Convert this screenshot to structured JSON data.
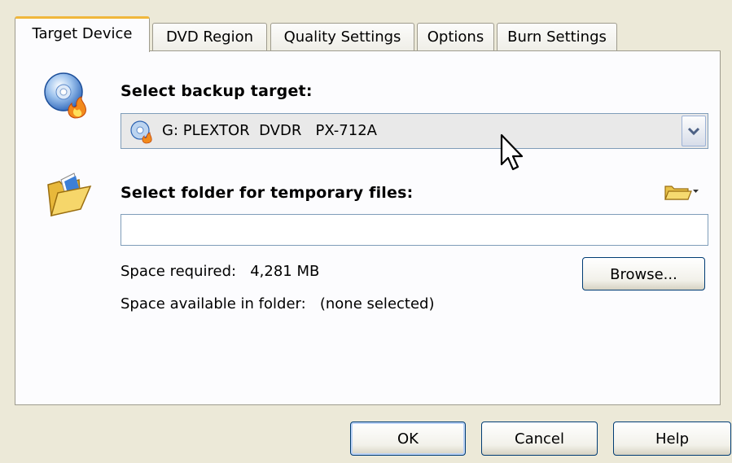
{
  "tabs": [
    {
      "label": "Target Device",
      "active": true
    },
    {
      "label": "DVD Region",
      "active": false
    },
    {
      "label": "Quality Settings",
      "active": false
    },
    {
      "label": "Options",
      "active": false
    },
    {
      "label": "Burn Settings",
      "active": false
    }
  ],
  "target": {
    "heading": "Select backup target:",
    "selected_drive": "G: PLEXTOR  DVDR   PX-712A",
    "icon": "cd-burn-icon"
  },
  "folder": {
    "heading": "Select folder for temporary files:",
    "input_value": "",
    "icon": "folder-open-icon"
  },
  "space": {
    "required": "Space required:   4,281 MB",
    "available": "Space available in folder:   (none selected)"
  },
  "buttons": {
    "browse": "Browse...",
    "ok": "OK",
    "cancel": "Cancel",
    "help": "Help"
  },
  "colors": {
    "active_tab_accent": "#f0b73c",
    "button_border": "#003c74",
    "dialog_background": "#ece9d8"
  }
}
